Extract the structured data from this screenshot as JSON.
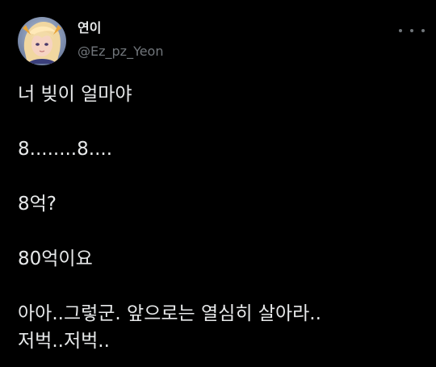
{
  "user": {
    "display_name": "연이",
    "handle": "@Ez_pz_Yeon",
    "avatar_icon": "anime-avatar-icon"
  },
  "menu": {
    "icon": "more-options-icon"
  },
  "tweet": {
    "lines": [
      "너 빚이 얼마야",
      "8........8....",
      "8억?",
      "80억이요",
      "아아..그렇군. 앞으로는 열심히 살아라..",
      "저벅..저벅.."
    ]
  },
  "colors": {
    "background": "#000000",
    "primary_text": "#e7e9ea",
    "secondary_text": "#71767b"
  }
}
